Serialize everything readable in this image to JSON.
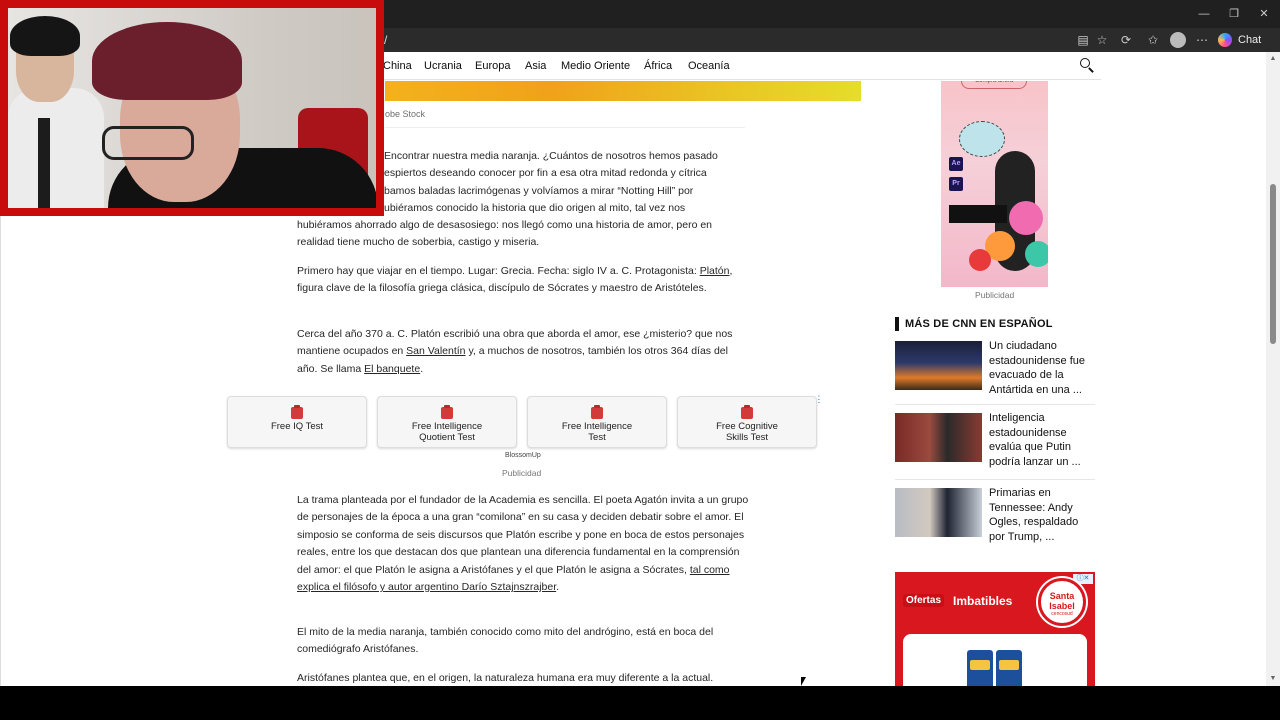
{
  "browser": {
    "address_fragment": "/",
    "chat_label": "Chat",
    "win_controls": [
      "—",
      "❐",
      "✕"
    ]
  },
  "nav": {
    "items": [
      "China",
      "Ucrania",
      "Europa",
      "Asia",
      "Medio Oriente",
      "África",
      "Oceanía"
    ]
  },
  "article": {
    "image_credit": "obe Stock",
    "p1_a": "Encontrar nuestra media naranja. ¿Cuántos de nosotros hemos pasado",
    "p1_b": "espiertos deseando conocer por fin a esa otra mitad redonda y cítrica",
    "p1_c": "bamos baladas lacrimógenas y volvíamos a mirar “Notting Hill” por",
    "p1_d": "ubiéramos conocido la historia que dio origen al mito, tal vez nos",
    "p1_e": "hubiéramos ahorrado algo de desasosiego: nos llegó como una historia de amor, pero en realidad tiene mucho de soberbia, castigo y miseria.",
    "p2_pre": "Primero hay que viajar en el tiempo. Lugar: Grecia. Fecha: siglo IV a. C. Protagonista: ",
    "p2_link": "Platón",
    "p2_post": ", figura clave de la filosofía griega clásica, discípulo de Sócrates y maestro de Aristóteles.",
    "p3_pre": "Cerca del año 370 a. C. Platón escribió una obra que aborda el amor, ese ¿misterio? que nos mantiene ocupados en ",
    "p3_link1": "San Valentín",
    "p3_mid": " y, a muchos de nosotros, también los otros 364 días del año. Se llama ",
    "p3_link2": "El banquete",
    "p3_post": ".",
    "p4_pre": "La trama planteada por el fundador de la Academia es sencilla. El poeta Agatón invita a un grupo de personajes de la época a una gran “comilona” en su casa y deciden debatir sobre el amor. El simposio se conforma de seis discursos que Platón escribe y pone en boca de estos personajes reales, entre los que destacan dos que plantean una diferencia fundamental en la comprensión del amor: el que Platón le asigna a Aristófanes y el que Platón le asigna a Sócrates, ",
    "p4_link": "tal como explica el filósofo y autor argentino Darío Sztajnszrajber",
    "p4_post": ".",
    "p5": "El mito de la media naranja, también conocido como mito del andrógino, está en boca del comediógrafo Aristófanes.",
    "p6": "Aristófanes plantea que, en el origen, la naturaleza humana era muy diferente a la actual."
  },
  "ad_strip": {
    "tiles": [
      {
        "label_1": "Free IQ Test",
        "label_2": ""
      },
      {
        "label_1": "Free Intelligence",
        "label_2": "Quotient Test"
      },
      {
        "label_1": "Free Intelligence",
        "label_2": "Test"
      },
      {
        "label_1": "Free Cognitive",
        "label_2": "Skills Test"
      }
    ],
    "brand": "BlossomUp",
    "publicidad": "Publicidad"
  },
  "sidebar": {
    "ad_pill": "Compra ahora",
    "ad_ae": "Ae",
    "ad_pr": "Pr",
    "publicidad": "Publicidad",
    "more_heading": "MÁS DE CNN EN ESPAÑOL",
    "stories": [
      {
        "title": "Un ciudadano estadounidense fue evacuado de la Antártida en una ..."
      },
      {
        "title": "Inteligencia estadounidense evalúa que Putin podría lanzar un ..."
      },
      {
        "title": "Primarias en Tennessee: Andy Ogles, respaldado por Trump, ..."
      }
    ],
    "promo_ofertas": "Ofertas",
    "promo_imbatibles": "Imbatibles",
    "promo_brand_1": "Santa",
    "promo_brand_2": "Isabel",
    "promo_brand_sub": "cencosud"
  },
  "colors": {
    "webcam_border": "#c80c0c",
    "promo_red": "#d9171f"
  }
}
